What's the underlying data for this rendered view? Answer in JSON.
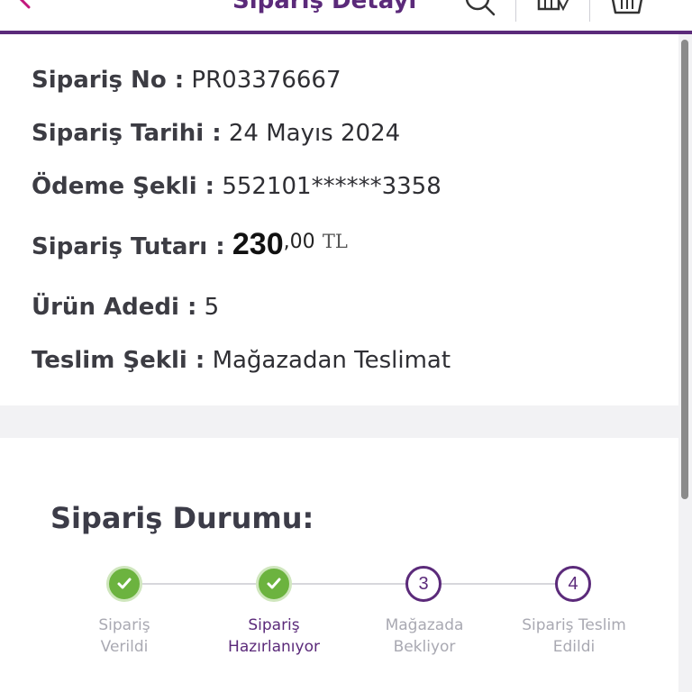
{
  "header": {
    "title": "Sipariş Detayı",
    "icons": [
      "back-arrow-icon",
      "search-icon",
      "store-location-icon",
      "basket-icon"
    ]
  },
  "order": {
    "no_label": "Sipariş No :",
    "no_value": "PR03376667",
    "date_label": "Sipariş Tarihi :",
    "date_value": "24 Mayıs 2024",
    "payment_label": "Ödeme Şekli :",
    "payment_value": "552101******3358",
    "amount_label": "Sipariş Tutarı :",
    "amount_int": "230",
    "amount_dec": ",00",
    "amount_currency": "TL",
    "count_label": "Ürün Adedi :",
    "count_value": "5",
    "delivery_label": "Teslim Şekli :",
    "delivery_value": "Mağazadan Teslimat"
  },
  "status": {
    "title": "Sipariş Durumu:",
    "steps": [
      {
        "line1": "Sipariş",
        "line2": "Verildi",
        "state": "done",
        "number": ""
      },
      {
        "line1": "Sipariş",
        "line2": "Hazırlanıyor",
        "state": "done",
        "number": ""
      },
      {
        "line1": "Mağazada",
        "line2": "Bekliyor",
        "state": "pending",
        "number": "3"
      },
      {
        "line1": "Sipariş Teslim",
        "line2": "Edildi",
        "state": "pending",
        "number": "4"
      }
    ]
  },
  "colors": {
    "brand": "#5b2a7a",
    "done": "#6cb33f",
    "inactive_text": "#a9a9b2"
  }
}
